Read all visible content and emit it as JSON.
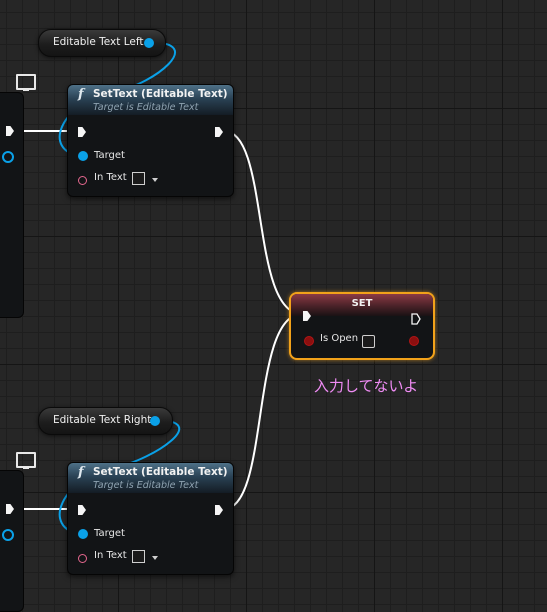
{
  "variables": {
    "left": {
      "label": "Editable Text Left"
    },
    "right": {
      "label": "Editable Text Right"
    }
  },
  "settext_nodes": [
    {
      "icon": "function-icon",
      "title": "SetText (Editable Text)",
      "subtitle": "Target is Editable Text",
      "target_label": "Target",
      "intext_label": "In Text"
    },
    {
      "icon": "function-icon",
      "title": "SetText (Editable Text)",
      "subtitle": "Target is Editable Text",
      "target_label": "Target",
      "intext_label": "In Text"
    }
  ],
  "set_node": {
    "title": "SET",
    "var_label": "Is Open",
    "highlight_color": "#f2a21a"
  },
  "comment": "入力してないよ",
  "colors": {
    "exec_wire": "#ffffff",
    "object_pin": "#0aa1e8",
    "text_pin": "#e4678e",
    "bool_pin": "#8b0f0f"
  }
}
